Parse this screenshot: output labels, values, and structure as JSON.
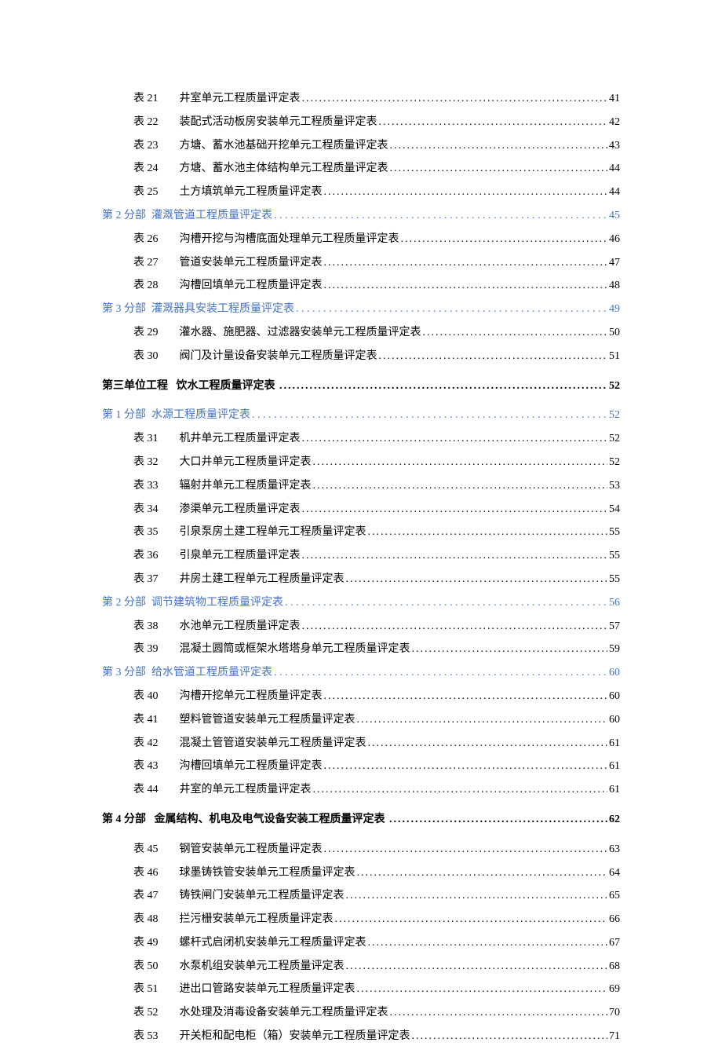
{
  "entries": [
    {
      "type": "table",
      "prefix": "表 21",
      "title": "井室单元工程质量评定表",
      "page": "41"
    },
    {
      "type": "table",
      "prefix": "表 22",
      "title": "装配式活动板房安装单元工程质量评定表",
      "page": "42"
    },
    {
      "type": "table",
      "prefix": "表 23",
      "title": "方塘、蓄水池基础开挖单元工程质量评定表",
      "page": "43"
    },
    {
      "type": "table",
      "prefix": "表 24",
      "title": "方塘、蓄水池主体结构单元工程质量评定表",
      "page": "44"
    },
    {
      "type": "table",
      "prefix": "表 25",
      "title": "土方填筑单元工程质量评定表",
      "page": "44"
    },
    {
      "type": "section",
      "prefix": "第 2 分部",
      "title": "灌溉管道工程质量评定表",
      "page": "45"
    },
    {
      "type": "table",
      "prefix": "表 26",
      "title": "沟槽开挖与沟槽底面处理单元工程质量评定表",
      "page": "46"
    },
    {
      "type": "table",
      "prefix": "表 27",
      "title": "管道安装单元工程质量评定表",
      "page": "47"
    },
    {
      "type": "table",
      "prefix": "表 28",
      "title": "沟槽回填单元工程质量评定表",
      "page": "48"
    },
    {
      "type": "section",
      "prefix": "第 3 分部",
      "title": "灌溉器具安装工程质量评定表",
      "page": "49"
    },
    {
      "type": "table",
      "prefix": "表 29",
      "title": "灌水器、施肥器、过滤器安装单元工程质量评定表",
      "page": "50"
    },
    {
      "type": "table",
      "prefix": "表 30",
      "title": "阀门及计量设备安装单元工程质量评定表",
      "page": "51"
    },
    {
      "type": "heading",
      "prefix": "第三单位工程",
      "title": "饮水工程质量评定表",
      "page": "52"
    },
    {
      "type": "section",
      "prefix": "第 1 分部",
      "title": "水源工程质量评定表",
      "page": "52"
    },
    {
      "type": "table",
      "prefix": "表 31",
      "title": "机井单元工程质量评定表",
      "page": "52"
    },
    {
      "type": "table",
      "prefix": "表 32",
      "title": "大口井单元工程质量评定表",
      "page": "52"
    },
    {
      "type": "table",
      "prefix": "表 33",
      "title": "辐射井单元工程质量评定表",
      "page": "53"
    },
    {
      "type": "table",
      "prefix": "表 34",
      "title": "渗渠单元工程质量评定表",
      "page": "54"
    },
    {
      "type": "table",
      "prefix": "表 35",
      "title": "引泉泵房土建工程单元工程质量评定表",
      "page": "55"
    },
    {
      "type": "table",
      "prefix": "表 36",
      "title": "引泉单元工程质量评定表",
      "page": "55"
    },
    {
      "type": "table",
      "prefix": "表 37",
      "title": "井房土建工程单元工程质量评定表",
      "page": "55"
    },
    {
      "type": "section",
      "prefix": "第 2 分部",
      "title": "调节建筑物工程质量评定表",
      "page": "56"
    },
    {
      "type": "table",
      "prefix": "表 38",
      "title": "水池单元工程质量评定表",
      "page": "57"
    },
    {
      "type": "table",
      "prefix": "表 39",
      "title": "混凝土圆筒或框架水塔塔身单元工程质量评定表",
      "page": "59"
    },
    {
      "type": "section",
      "prefix": "第 3 分部",
      "title": "给水管道工程质量评定表",
      "page": "60"
    },
    {
      "type": "table",
      "prefix": "表 40",
      "title": "沟槽开挖单元工程质量评定表",
      "page": "60"
    },
    {
      "type": "table",
      "prefix": "表 41",
      "title": "塑料管管道安装单元工程质量评定表",
      "page": "60"
    },
    {
      "type": "table",
      "prefix": "表 42",
      "title": "混凝土管管道安装单元工程质量评定表",
      "page": "61"
    },
    {
      "type": "table",
      "prefix": "表 43",
      "title": "沟槽回填单元工程质量评定表",
      "page": "61"
    },
    {
      "type": "table",
      "prefix": "表 44",
      "title": "井室的单元工程质量评定表",
      "page": "61"
    },
    {
      "type": "heading-bold",
      "prefix": "第 4 分部",
      "title": "金属结构、机电及电气设备安装工程质量评定表",
      "page": "62"
    },
    {
      "type": "table",
      "prefix": "表 45",
      "title": "钢管安装单元工程质量评定表",
      "page": "63"
    },
    {
      "type": "table",
      "prefix": "表 46",
      "title": "球墨铸铁管安装单元工程质量评定表",
      "page": "64"
    },
    {
      "type": "table",
      "prefix": "表 47",
      "title": "铸铁闸门安装单元工程质量评定表",
      "page": "65"
    },
    {
      "type": "table",
      "prefix": "表 48",
      "title": "拦污栅安装单元工程质量评定表",
      "page": "66"
    },
    {
      "type": "table",
      "prefix": "表 49",
      "title": "螺杆式启闭机安装单元工程质量评定表",
      "page": "67"
    },
    {
      "type": "table",
      "prefix": "表 50",
      "title": "水泵机组安装单元工程质量评定表",
      "page": "68"
    },
    {
      "type": "table",
      "prefix": "表 51",
      "title": "进出口管路安装单元工程质量评定表",
      "page": "69"
    },
    {
      "type": "table",
      "prefix": "表 52",
      "title": "水处理及消毒设备安装单元工程质量评定表",
      "page": "70"
    },
    {
      "type": "table",
      "prefix": "表 53",
      "title": "开关柜和配电柜（箱）安装单元工程质量评定表",
      "page": "71"
    }
  ]
}
